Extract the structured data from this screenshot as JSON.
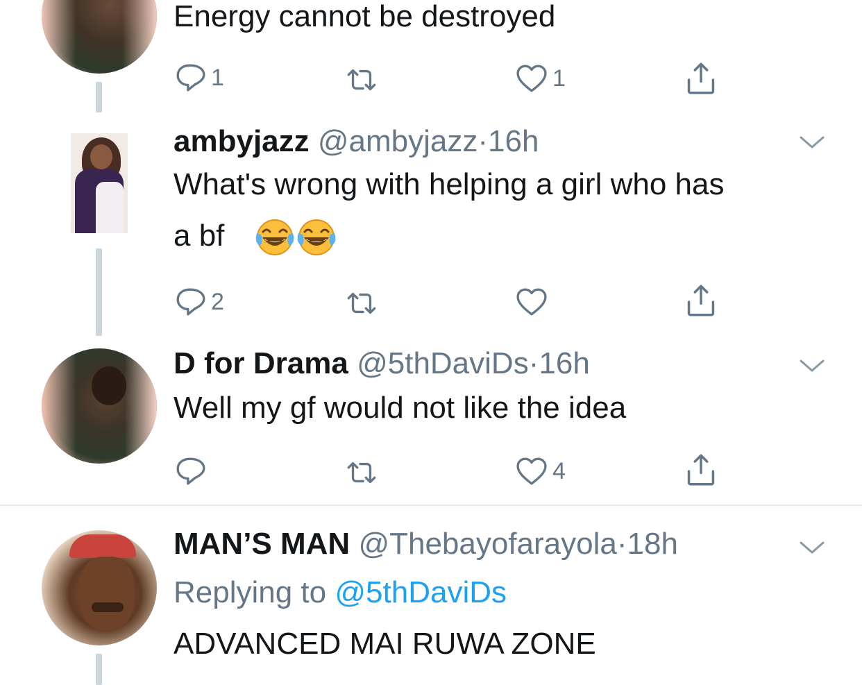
{
  "tweets": [
    {
      "text": "Energy cannot be destroyed",
      "actions": {
        "reply_count": "1",
        "retweet_count": "",
        "like_count": "1"
      }
    },
    {
      "name": "ambyjazz",
      "handle": "@ambyjazz",
      "separator": "·",
      "time": "16h",
      "text_line1": "What's wrong with helping a girl who has",
      "text_line2": "a bf",
      "emoji": "face-with-tears-of-joy x2",
      "actions": {
        "reply_count": "2",
        "retweet_count": "",
        "like_count": ""
      }
    },
    {
      "name": "D for Drama",
      "handle": "@5thDaviDs",
      "separator": "·",
      "time": "16h",
      "text": "Well my gf would not like the idea",
      "actions": {
        "reply_count": "",
        "retweet_count": "",
        "like_count": "4"
      }
    },
    {
      "name": "MAN’S MAN",
      "handle": "@Thebayofarayola",
      "separator": "·",
      "time": "18h",
      "replying_label": "Replying to",
      "replying_handle": "@5thDaviDs",
      "text": "ADVANCED MAI RUWA ZONE"
    }
  ],
  "icons": {
    "reply": "reply-bubble-icon",
    "retweet": "retweet-icon",
    "like": "heart-icon",
    "share": "share-icon",
    "menu": "chevron-down-icon"
  },
  "colors": {
    "text": "#14171a",
    "secondary": "#657786",
    "link": "#1da1f2",
    "thread_line": "#ccd6dd",
    "divider": "#e1e8ed"
  }
}
